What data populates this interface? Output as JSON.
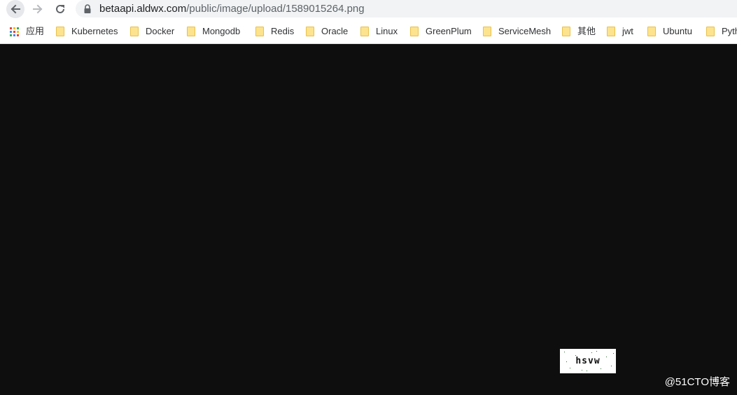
{
  "address_bar": {
    "url_host": "betaapi.aldwx.com",
    "url_path": "/public/image/upload/1589015264.png"
  },
  "bookmarks": {
    "apps_label": "应用",
    "items": [
      {
        "label": "Kubernetes"
      },
      {
        "label": "Docker"
      },
      {
        "label": "Mongodb"
      },
      {
        "label": "Redis"
      },
      {
        "label": "Oracle"
      },
      {
        "label": "Linux"
      },
      {
        "label": "GreenPlum"
      },
      {
        "label": "ServiceMesh"
      },
      {
        "label": "其他"
      },
      {
        "label": "jwt"
      },
      {
        "label": "Ubuntu"
      },
      {
        "label": "Pyth"
      }
    ]
  },
  "captcha": {
    "text": "hsvw"
  },
  "watermark": {
    "text": "@51CTO博客"
  },
  "colors": {
    "page_background": "#0e0e0e",
    "folder": "#fde38d",
    "chrome": "#ffffff"
  },
  "icons": [
    "back-arrow-icon",
    "forward-arrow-icon",
    "reload-icon",
    "lock-icon",
    "apps-grid-icon",
    "folder-icon"
  ]
}
